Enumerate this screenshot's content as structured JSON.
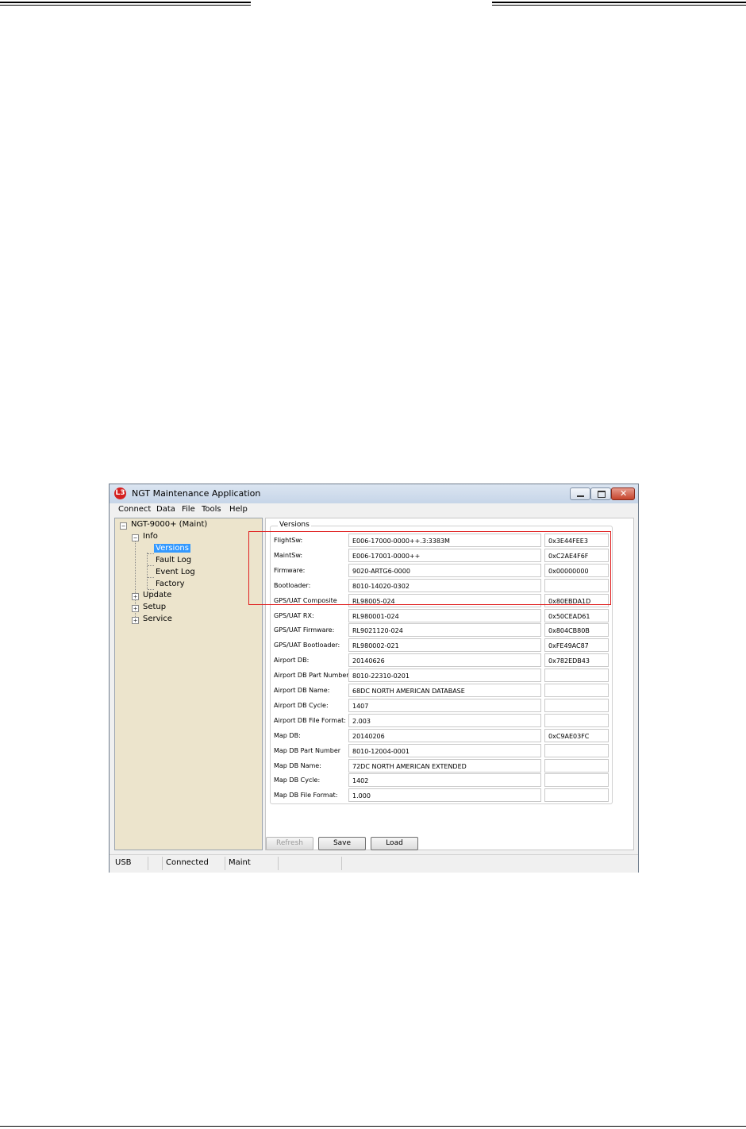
{
  "window": {
    "title": "NGT Maintenance Application",
    "app_icon_glyph": "L3",
    "close_glyph": "✕"
  },
  "menu": [
    "Connect",
    "Data",
    "File",
    "Tools",
    "Help"
  ],
  "tree": {
    "root": "NGT-9000+ (Maint)",
    "info": "Info",
    "info_children": [
      "Versions",
      "Fault Log",
      "Event Log",
      "Factory"
    ],
    "others": [
      "Update",
      "Setup",
      "Service"
    ],
    "selected": "Versions"
  },
  "versions": {
    "group_title": "Versions",
    "rows": [
      {
        "label": "FlightSw:",
        "value": "E006-17000-0000++.3:3383M",
        "crc": "0x3E44FEE3"
      },
      {
        "label": "MaintSw:",
        "value": "E006-17001-0000++",
        "crc": "0xC2AE4F6F"
      },
      {
        "label": "Firmware:",
        "value": "9020-ARTG6-0000",
        "crc": "0x00000000"
      },
      {
        "label": "Bootloader:",
        "value": "8010-14020-0302",
        "crc": ""
      },
      {
        "label": "GPS/UAT Composite",
        "value": "RL98005-024",
        "crc": "0x80EBDA1D"
      },
      {
        "label": "GPS/UAT RX:",
        "value": "RL980001-024",
        "crc": "0x50CEAD61"
      },
      {
        "label": "GPS/UAT Firmware:",
        "value": "RL9021120-024",
        "crc": "0x804CB80B"
      },
      {
        "label": "GPS/UAT Bootloader:",
        "value": "RL980002-021",
        "crc": "0xFE49AC87"
      },
      {
        "label": "Airport DB:",
        "value": "20140626",
        "crc": "0x782EDB43"
      },
      {
        "label": "Airport DB Part Number",
        "value": "8010-22310-0201",
        "crc": ""
      },
      {
        "label": "Airport DB Name:",
        "value": "68DC NORTH AMERICAN DATABASE",
        "crc": ""
      },
      {
        "label": "Airport DB Cycle:",
        "value": "1407",
        "crc": ""
      },
      {
        "label": "Airport DB File Format:",
        "value": "2.003",
        "crc": ""
      },
      {
        "label": "Map DB:",
        "value": "20140206",
        "crc": "0xC9AE03FC"
      },
      {
        "label": "Map DB Part Number",
        "value": "8010-12004-0001",
        "crc": ""
      },
      {
        "label": "Map DB Name:",
        "value": "72DC NORTH AMERICAN EXTENDED",
        "crc": ""
      },
      {
        "label": "Map DB Cycle:",
        "value": "1402",
        "crc": ""
      },
      {
        "label": "Map DB File Format:",
        "value": "1.000",
        "crc": ""
      }
    ]
  },
  "buttons": {
    "refresh": "Refresh",
    "save": "Save",
    "load": "Load"
  },
  "status": {
    "port": "USB",
    "connection": "Connected",
    "mode": "Maint"
  }
}
